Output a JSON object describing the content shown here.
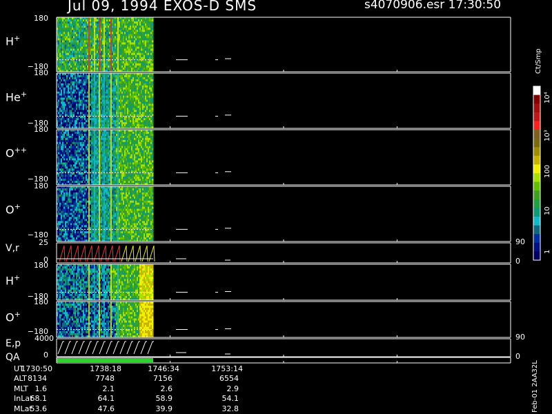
{
  "header": {
    "date_instrument": "Jul 09, 1994   EXOS-D SMS",
    "file_time": "s4070906.esr  17:30:50"
  },
  "colorbar": {
    "unit_label": "Ct/Smp",
    "ticks": [
      "10⁴",
      "10³",
      "100",
      "10",
      "1"
    ],
    "colors": [
      "#ffffff",
      "#800000",
      "#a01010",
      "#c01818",
      "#ff2020",
      "#806020",
      "#7a6a10",
      "#a08c00",
      "#c8b400",
      "#f0f000",
      "#a8e000",
      "#60c000",
      "#40a020",
      "#20a040",
      "#109878",
      "#10b8c8",
      "#106880",
      "#0030a0",
      "#001080",
      "#000060"
    ]
  },
  "panels": [
    {
      "label": "H",
      "charge": "+",
      "y_top": "180",
      "y_bot": "−180"
    },
    {
      "label": "He",
      "charge": "+",
      "y_top": "180",
      "y_bot": "−180"
    },
    {
      "label": "O",
      "charge": "++",
      "y_top": "180",
      "y_bot": "−180"
    },
    {
      "label": "O",
      "charge": "+",
      "y_top": "180",
      "y_bot": "−180"
    },
    {
      "label": "V,r",
      "charge": "",
      "y_top": "25",
      "y_bot": "0",
      "r_top": "90",
      "r_bot": "0"
    },
    {
      "label": "H",
      "charge": "+",
      "y_top": "180",
      "y_bot": "−180"
    },
    {
      "label": "O",
      "charge": "+",
      "y_top": "180",
      "y_bot": "−180"
    },
    {
      "label": "E,p",
      "charge": "",
      "y_top": "4000",
      "y_bot": "0",
      "r_top": "90",
      "r_bot": "0"
    },
    {
      "label": "QA",
      "charge": ""
    }
  ],
  "orbit": {
    "rows": [
      {
        "name": "UT",
        "values": [
          "1730:50",
          "1738:18",
          "1746:34",
          "1753:14"
        ]
      },
      {
        "name": "ALT",
        "values": [
          "8134",
          "7748",
          "7156",
          "6554"
        ]
      },
      {
        "name": "MLT",
        "values": [
          "1.6",
          "2.1",
          "2.6",
          "2.9"
        ]
      },
      {
        "name": "InLat",
        "values": [
          "68.1",
          "64.1",
          "58.9",
          "54.1"
        ]
      },
      {
        "name": "MLat",
        "values": [
          "53.6",
          "47.6",
          "39.9",
          "32.8"
        ]
      }
    ]
  },
  "footer": {
    "side_label": "Feb-01 2AA32L"
  },
  "chart_data": {
    "type": "heatmap",
    "title": "Jul 09, 1994   EXOS-D SMS",
    "x_ticks": [
      "1730:50",
      "1738:18",
      "1746:34",
      "1753:14"
    ],
    "series": [
      {
        "name": "H+",
        "ylim": [
          -180,
          180
        ]
      },
      {
        "name": "He+",
        "ylim": [
          -180,
          180
        ]
      },
      {
        "name": "O++",
        "ylim": [
          -180,
          180
        ]
      },
      {
        "name": "O+",
        "ylim": [
          -180,
          180
        ]
      },
      {
        "name": "V,r",
        "ylim": [
          0,
          25
        ]
      },
      {
        "name": "H+",
        "ylim": [
          -180,
          180
        ]
      },
      {
        "name": "O+",
        "ylim": [
          -180,
          180
        ]
      },
      {
        "name": "E,p",
        "ylim": [
          0,
          4000
        ]
      }
    ],
    "colorbar_ticks": [
      "1",
      "10",
      "100",
      "10³",
      "10⁴"
    ],
    "colorbar_unit": "Ct/Smp"
  }
}
